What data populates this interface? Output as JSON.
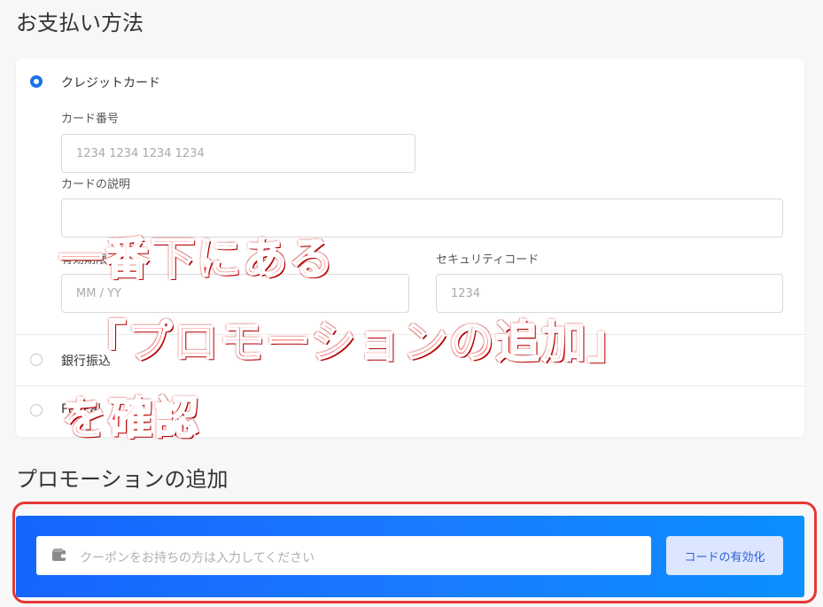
{
  "payment": {
    "section_title": "お支払い方法",
    "options": [
      {
        "label": "クレジットカード",
        "selected": true
      },
      {
        "label": "銀行振込",
        "selected": false
      },
      {
        "label": "PayPal",
        "selected": false
      }
    ],
    "card_number": {
      "label": "カード番号",
      "placeholder": "1234 1234 1234 1234"
    },
    "card_description": {
      "label": "カードの説明",
      "placeholder": ""
    },
    "expiry": {
      "label": "有効期限",
      "placeholder": "MM / YY"
    },
    "security_code": {
      "label": "セキュリティコード",
      "placeholder": "1234"
    }
  },
  "promotion": {
    "section_title": "プロモーションの追加",
    "coupon_placeholder": "クーポンをお持ちの方は入力してください",
    "activate_label": "コードの有効化",
    "wallet_icon": "wallet-icon",
    "bar_gradient": [
      "#1565ff",
      "#0a8fff"
    ]
  },
  "annotation": {
    "line1": "一番下にある",
    "line2": "「プロモーションの追加」",
    "line3": "を確認",
    "color": "#ff3b3b",
    "frame_color": "#e53935"
  }
}
